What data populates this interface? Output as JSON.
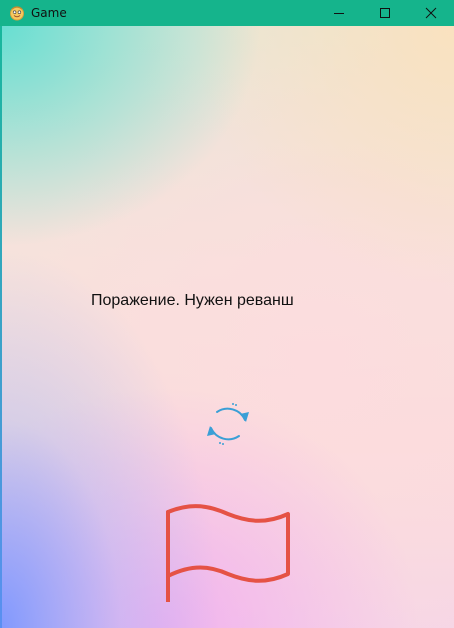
{
  "window": {
    "title": "Game",
    "app_icon": "smiley-face-icon",
    "controls": [
      "minimize-icon",
      "maximize-icon",
      "close-icon"
    ],
    "titlebar_color": "#15b48c"
  },
  "main": {
    "message": "Поражение. Нужен реванш",
    "restart_icon": "refresh-icon",
    "flag_icon": "flag-icon",
    "flag_color": "#e55245",
    "refresh_color": "#3a9fd6"
  }
}
